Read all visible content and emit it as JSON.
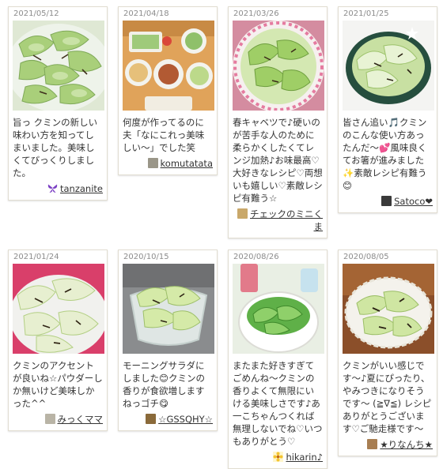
{
  "cards": [
    {
      "date": "2021/05/12",
      "comment": "旨っ クミンの新しい味わい方を知ってしまいました。美味しくてびっくりしました。",
      "author": "tanzanite",
      "avatar": "butterfly-avatar"
    },
    {
      "date": "2021/04/18",
      "comment": "何度が作ってるのに夫「なにこれっ美味しい〜」でした笑",
      "author": "komutatata",
      "avatar": "photo-avatar"
    },
    {
      "date": "2021/03/26",
      "comment": "春キャベツで♪硬いのが苦手な人のために柔らかくしたくてレンジ加熱♪お味最高♡大好きなレシピ♡両想いも嬉しい♡素敵レシピ有難う☆",
      "author": "チェックのミニくま",
      "avatar": "photo-avatar"
    },
    {
      "date": "2021/01/25",
      "comment": "皆さん追い🎵クミンのこんな使い方あったんだ～💕風味良くてお箸が進みました✨素敵レシピ有難う😊",
      "author": "Satoco❤",
      "avatar": "photo-avatar"
    },
    {
      "date": "2021/01/24",
      "comment": "クミンのアクセントが良いね☆パウダーしか無いけど美味しかった^^",
      "author": "みっくママ",
      "avatar": "photo-avatar"
    },
    {
      "date": "2020/10/15",
      "comment": "モーニングサラダにしました😊クミンの香りが食欲増しますねっゴチ😋",
      "author": "☆GSSQHY☆",
      "avatar": "photo-avatar"
    },
    {
      "date": "2020/08/26",
      "comment": "またまた好きすぎてごめんね～クミンの香りよくて無限にいける美味しさです♪あ一こちゃんつくれば無理しないでね♡いつもありがとう♡",
      "author": "hikarin♪",
      "avatar": "flower-avatar"
    },
    {
      "date": "2020/08/05",
      "comment": "クミンがいい感じです〜♪夏にぴったり、やみつきになりそうです〜 (≧∇≦) レシピありがとうございます♡ご馳走様です〜",
      "author": "★りなんち★",
      "avatar": "photo-avatar"
    }
  ],
  "colors": {
    "border": "#e1ddd1",
    "date": "#8c8c8c",
    "text": "#333333"
  }
}
